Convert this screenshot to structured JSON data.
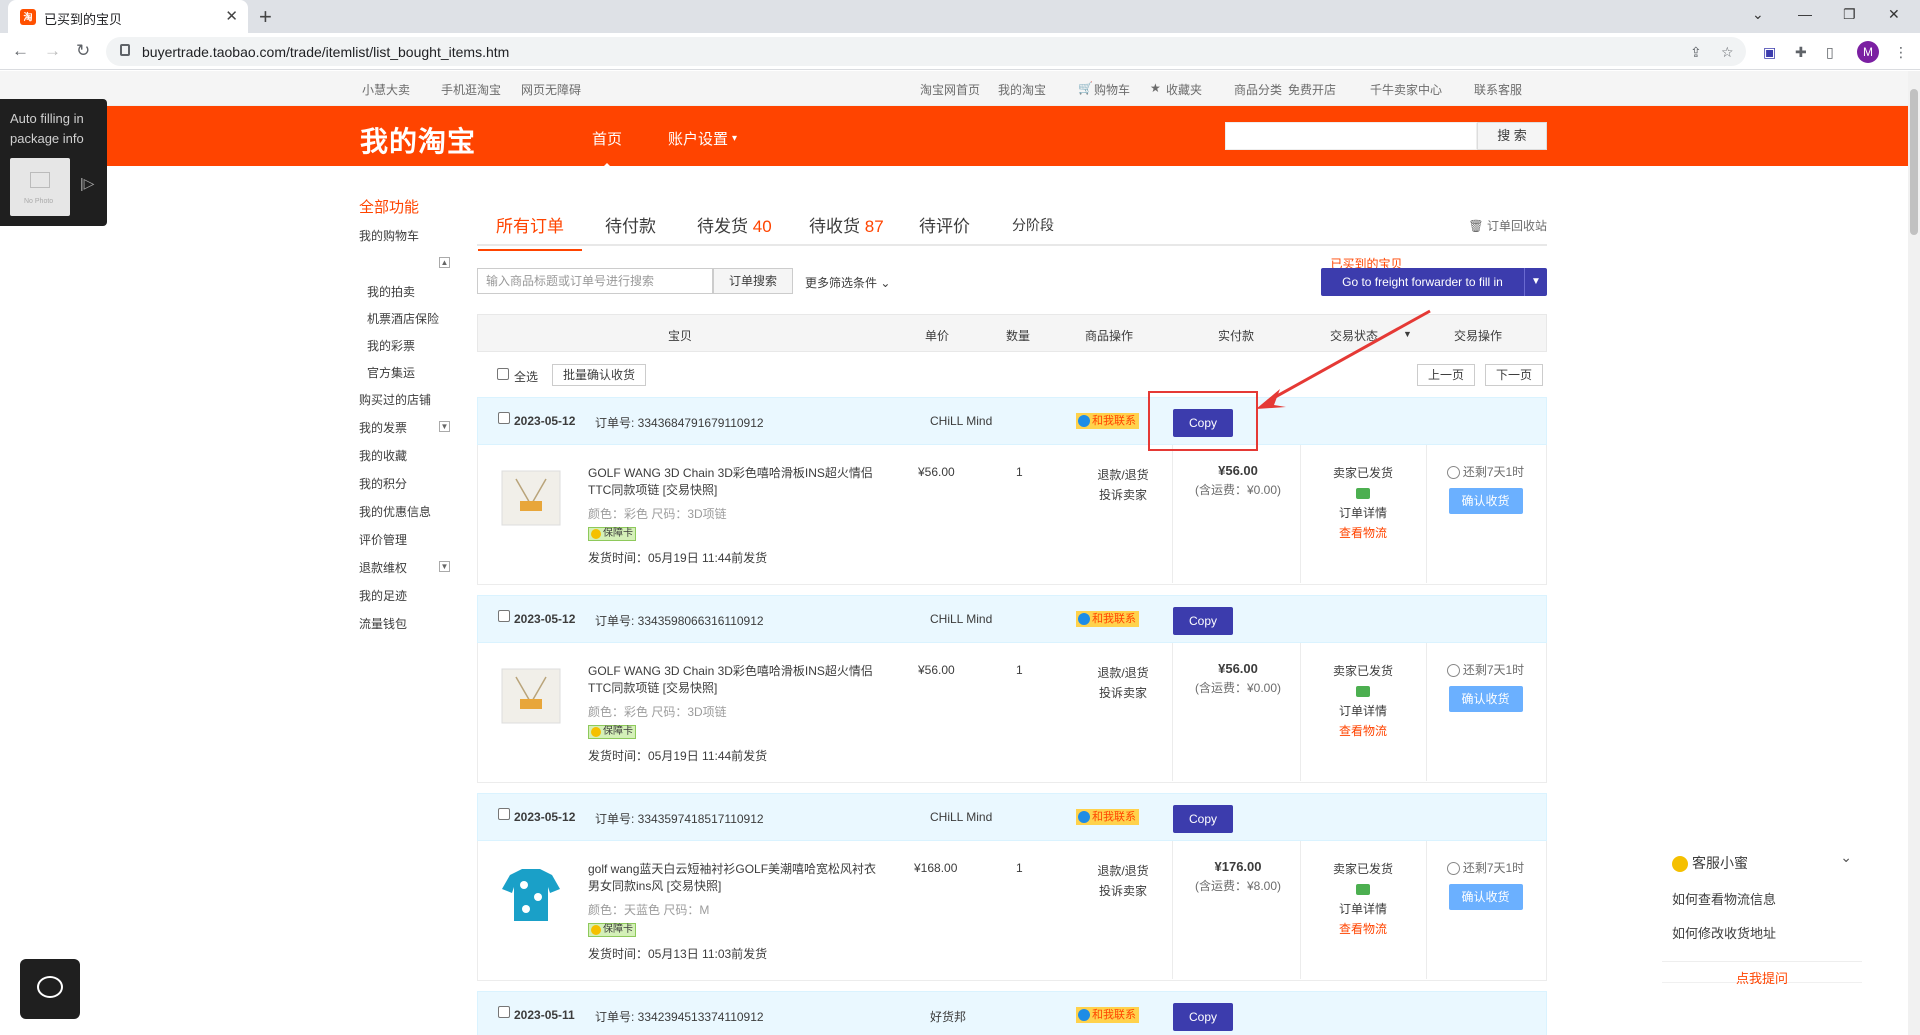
{
  "browser": {
    "tab_title": "已买到的宝贝",
    "url": "buyertrade.taobao.com/trade/itemlist/list_bought_items.htm",
    "profile_initial": "M"
  },
  "topbar": {
    "left": [
      "小慧大卖",
      "手机逛淘宝",
      "网页无障碍"
    ],
    "right": [
      "淘宝网首页",
      "我的淘宝",
      "购物车",
      "收藏夹",
      "商品分类",
      "免费开店",
      "千牛卖家中心",
      "联系客服"
    ]
  },
  "header": {
    "logo": "我的淘宝",
    "nav_home": "首页",
    "nav_account": "账户设置",
    "search_button": "搜 索"
  },
  "sidebar": {
    "title": "全部功能",
    "items": [
      "我的购物车",
      "已买到的宝贝",
      "我的拍卖",
      "机票酒店保险",
      "我的彩票",
      "官方集运",
      "购买过的店铺",
      "我的发票",
      "我的收藏",
      "我的积分",
      "我的优惠信息",
      "评价管理",
      "退款维权",
      "我的足迹",
      "流量钱包"
    ]
  },
  "tabs": {
    "all": "所有订单",
    "pending_pay": "待付款",
    "pending_ship": "待发货",
    "pending_ship_count": "40",
    "pending_receive": "待收货",
    "pending_receive_count": "87",
    "pending_review": "待评价",
    "installment": "分阶段",
    "recycle": "订单回收站"
  },
  "search": {
    "placeholder": "输入商品标题或订单号进行搜索",
    "button": "订单搜索",
    "more": "更多筛选条件",
    "freight_button": "Go to freight forwarder to fill in"
  },
  "table_header": {
    "item": "宝贝",
    "unit_price": "单价",
    "qty": "数量",
    "item_ops": "商品操作",
    "paid": "实付款",
    "status": "交易状态",
    "actions": "交易操作"
  },
  "batch": {
    "select_all": "全选",
    "confirm_all": "批量确认收货",
    "prev": "上一页",
    "next": "下一页"
  },
  "orders": [
    {
      "date": "2023-05-12",
      "order_no": "订单号: 3343684791679110912",
      "shop": "CHiLL Mind",
      "contact": "和我联系",
      "copy": "Copy",
      "title": "GOLF WANG 3D Chain 3D彩色嘻哈滑板INS超火情侣TTC同款项链 [交易快照]",
      "attr": "颜色：彩色  尺码：3D项链",
      "badge": "保障卡",
      "ship_time": "发货时间：05月19日 11:44前发货",
      "price": "¥56.00",
      "qty": "1",
      "op1": "退款/退货",
      "op2": "投诉卖家",
      "paid": "¥56.00",
      "shipping": "(含运费：¥0.00)",
      "status1": "卖家已发货",
      "status3": "订单详情",
      "status4": "查看物流",
      "remain": "还剩7天1时",
      "confirm": "确认收货"
    },
    {
      "date": "2023-05-12",
      "order_no": "订单号: 3343598066316110912",
      "shop": "CHiLL Mind",
      "contact": "和我联系",
      "copy": "Copy",
      "title": "GOLF WANG 3D Chain 3D彩色嘻哈滑板INS超火情侣TTC同款项链 [交易快照]",
      "attr": "颜色：彩色  尺码：3D项链",
      "badge": "保障卡",
      "ship_time": "发货时间：05月19日 11:44前发货",
      "price": "¥56.00",
      "qty": "1",
      "op1": "退款/退货",
      "op2": "投诉卖家",
      "paid": "¥56.00",
      "shipping": "(含运费：¥0.00)",
      "status1": "卖家已发货",
      "status3": "订单详情",
      "status4": "查看物流",
      "remain": "还剩7天1时",
      "confirm": "确认收货"
    },
    {
      "date": "2023-05-12",
      "order_no": "订单号: 3343597418517110912",
      "shop": "CHiLL Mind",
      "contact": "和我联系",
      "copy": "Copy",
      "title": "golf wang蓝天白云短袖衬衫GOLF美潮嘻哈宽松风衬衣男女同款ins风 [交易快照]",
      "attr": "颜色：天蓝色  尺码：M",
      "badge": "保障卡",
      "ship_time": "发货时间：05月13日 11:03前发货",
      "price": "¥168.00",
      "qty": "1",
      "op1": "退款/退货",
      "op2": "投诉卖家",
      "paid": "¥176.00",
      "shipping": "(含运费：¥8.00)",
      "status1": "卖家已发货",
      "status3": "订单详情",
      "status4": "查看物流",
      "remain": "还剩7天1时",
      "confirm": "确认收货"
    },
    {
      "date": "2023-05-11",
      "order_no": "订单号: 3342394513374110912",
      "shop": "好货邦",
      "contact": "和我联系",
      "copy": "Copy"
    }
  ],
  "overlay": {
    "autofill": "Auto filling in package info",
    "no_photo": "No Photo"
  },
  "service": {
    "title": "客服小蜜",
    "q1": "如何查看物流信息",
    "q2": "如何修改收货地址",
    "ask": "点我提问"
  }
}
